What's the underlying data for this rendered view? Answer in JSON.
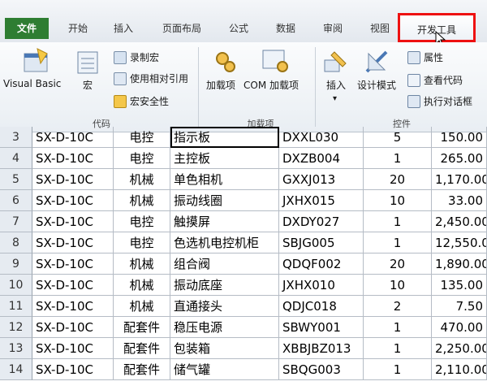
{
  "tabs": {
    "file": "文件",
    "home": "开始",
    "insert": "插入",
    "page_layout": "页面布局",
    "formulas": "公式",
    "data": "数据",
    "review": "审阅",
    "view": "视图",
    "developer": "开发工具"
  },
  "ribbon": {
    "code_group": {
      "label": "代码",
      "visual_basic": "Visual Basic",
      "macros": "宏",
      "record_macro": "录制宏",
      "relative_refs": "使用相对引用",
      "macro_security": "宏安全性"
    },
    "addins_group": {
      "label": "加载项",
      "addins": "加载项",
      "com_addins": "COM 加载项"
    },
    "controls_group": {
      "label": "控件",
      "insert": "插入",
      "design_mode": "设计模式",
      "properties": "属性",
      "view_code": "查看代码",
      "run_dialog": "执行对话框"
    }
  },
  "rows": [
    {
      "n": "3",
      "b": "SX-D-10C",
      "c": "电控",
      "d": "指示板",
      "e": "DXXL030",
      "f": "5",
      "g": "150.00"
    },
    {
      "n": "4",
      "b": "SX-D-10C",
      "c": "电控",
      "d": "主控板",
      "e": "DXZB004",
      "f": "1",
      "g": "265.00"
    },
    {
      "n": "5",
      "b": "SX-D-10C",
      "c": "机械",
      "d": "单色相机",
      "e": "GXXJ013",
      "f": "20",
      "g": "1,170.00"
    },
    {
      "n": "6",
      "b": "SX-D-10C",
      "c": "机械",
      "d": "振动线圈",
      "e": "JXHX015",
      "f": "10",
      "g": "33.00"
    },
    {
      "n": "7",
      "b": "SX-D-10C",
      "c": "电控",
      "d": "触摸屏",
      "e": "DXDY027",
      "f": "1",
      "g": "2,450.00"
    },
    {
      "n": "8",
      "b": "SX-D-10C",
      "c": "电控",
      "d": "色选机电控机柜",
      "e": "SBJG005",
      "f": "1",
      "g": "12,550.00"
    },
    {
      "n": "9",
      "b": "SX-D-10C",
      "c": "机械",
      "d": "组合阀",
      "e": "QDQF002",
      "f": "20",
      "g": "1,890.00"
    },
    {
      "n": "10",
      "b": "SX-D-10C",
      "c": "机械",
      "d": "振动底座",
      "e": "JXHX010",
      "f": "10",
      "g": "135.00"
    },
    {
      "n": "11",
      "b": "SX-D-10C",
      "c": "机械",
      "d": "直通接头",
      "e": "QDJC018",
      "f": "2",
      "g": "7.50"
    },
    {
      "n": "12",
      "b": "SX-D-10C",
      "c": "配套件",
      "d": "稳压电源",
      "e": "SBWY001",
      "f": "1",
      "g": "470.00"
    },
    {
      "n": "13",
      "b": "SX-D-10C",
      "c": "配套件",
      "d": "包装箱",
      "e": "XBBJBZ013",
      "f": "1",
      "g": "2,250.00"
    },
    {
      "n": "14",
      "b": "SX-D-10C",
      "c": "配套件",
      "d": "储气罐",
      "e": "SBQG003",
      "f": "1",
      "g": "2,110.00"
    }
  ]
}
